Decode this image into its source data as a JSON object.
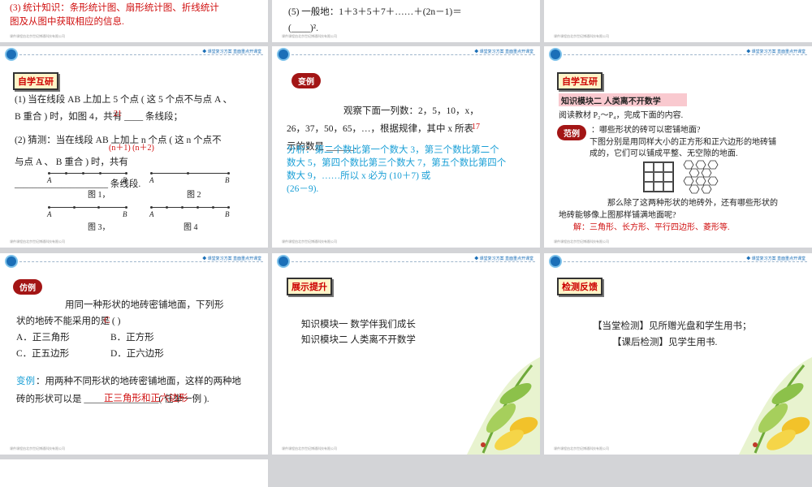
{
  "top": {
    "left_lines": [
      "(3) 统计知识：条形统计图、扇形统计图、折线统计",
      "图及从图中获取相应的信息."
    ],
    "mid_line1": "(5) 一般地：1＋3＋5＋7＋……＋(2n－1)＝",
    "mid_line2": "(____)²."
  },
  "header_text": "◆ 课堂复习方案  直面重点开课堂",
  "footer_text": "课件课程由北京世纪博通科技有限公司",
  "s4": {
    "tag": "自学互研",
    "lines": [
      "(1) 当在线段 AB 上加上 5 个点 ( 这 5 个点不与点 A 、",
      "B 重合 ) 时，如图 4，共有 ____ 条线段；",
      "(2) 猜测：当在线段 AB 上加上 n 个点 ( 这 n 个点不",
      "与点 A 、 B 重合 ) 时，共有",
      "____________________ 条线段."
    ],
    "answer1": "21",
    "answer2": "(n＋1)    (n＋2)",
    "fig_caps": [
      "图 1，",
      "图 2",
      "图 3，",
      "图 4"
    ],
    "pt_a": "A",
    "pt_b": "B"
  },
  "s5": {
    "tag": "变例",
    "lines": [
      "观察下面一列数：2，5，10，x，",
      "26，37，50，65，…，根据规律，其中 x 所表",
      "示的数是 ______."
    ],
    "answer": "17",
    "explain": [
      "分析：第二个数比第一个数大 3，第三个数比第二个",
      "数大 5，第四个数比第三个数大 7，第五个数比第四个",
      "数大 9，……所以 x 必为 (10＋7) 或",
      "(26－9)."
    ]
  },
  "s6": {
    "tag": "自学互研",
    "module": "知识模块二   人类离不开数学",
    "read": "阅读教材 P₂～P₄，完成下面的内容.",
    "pill": "范例",
    "q": [
      "：哪些形状的砖可以密铺地面?",
      "下图分别是用同样大小的正方形和正六边形的地砖铺",
      "成的，它们可以铺成平整、无空隙的地面."
    ],
    "q2": [
      "那么除了这两种形状的地砖外，还有哪些形状的",
      "地砖能够像上图那样铺满地面呢?"
    ],
    "answer": "解：三角形、长方形、平行四边形、菱形等."
  },
  "s7": {
    "pill": "仿例",
    "lines": [
      "用同一种形状的地砖密铺地面，下列形",
      "状的地砖不能采用的是 (        )"
    ],
    "answer": "C",
    "opts": [
      "A．正三角形",
      "B．正方形",
      "C．正五边形",
      "D．正六边形"
    ],
    "variant_label": "变例",
    "variant": [
      "：用两种不同形状的地砖密铺地面，这样的两种地",
      "砖的形状可以是 ________________( 任举一例 )."
    ],
    "variant_answer": "正三角形和正六边形"
  },
  "s8": {
    "tag": "展示提升",
    "lines": [
      "知识模块一    数学伴我们成长",
      "知识模块二    人类离不开数学"
    ]
  },
  "s9": {
    "tag": "检测反馈",
    "lines": [
      "【当堂检测】见所赠光盘和学生用书；",
      "【课后检测】见学生用书."
    ]
  }
}
